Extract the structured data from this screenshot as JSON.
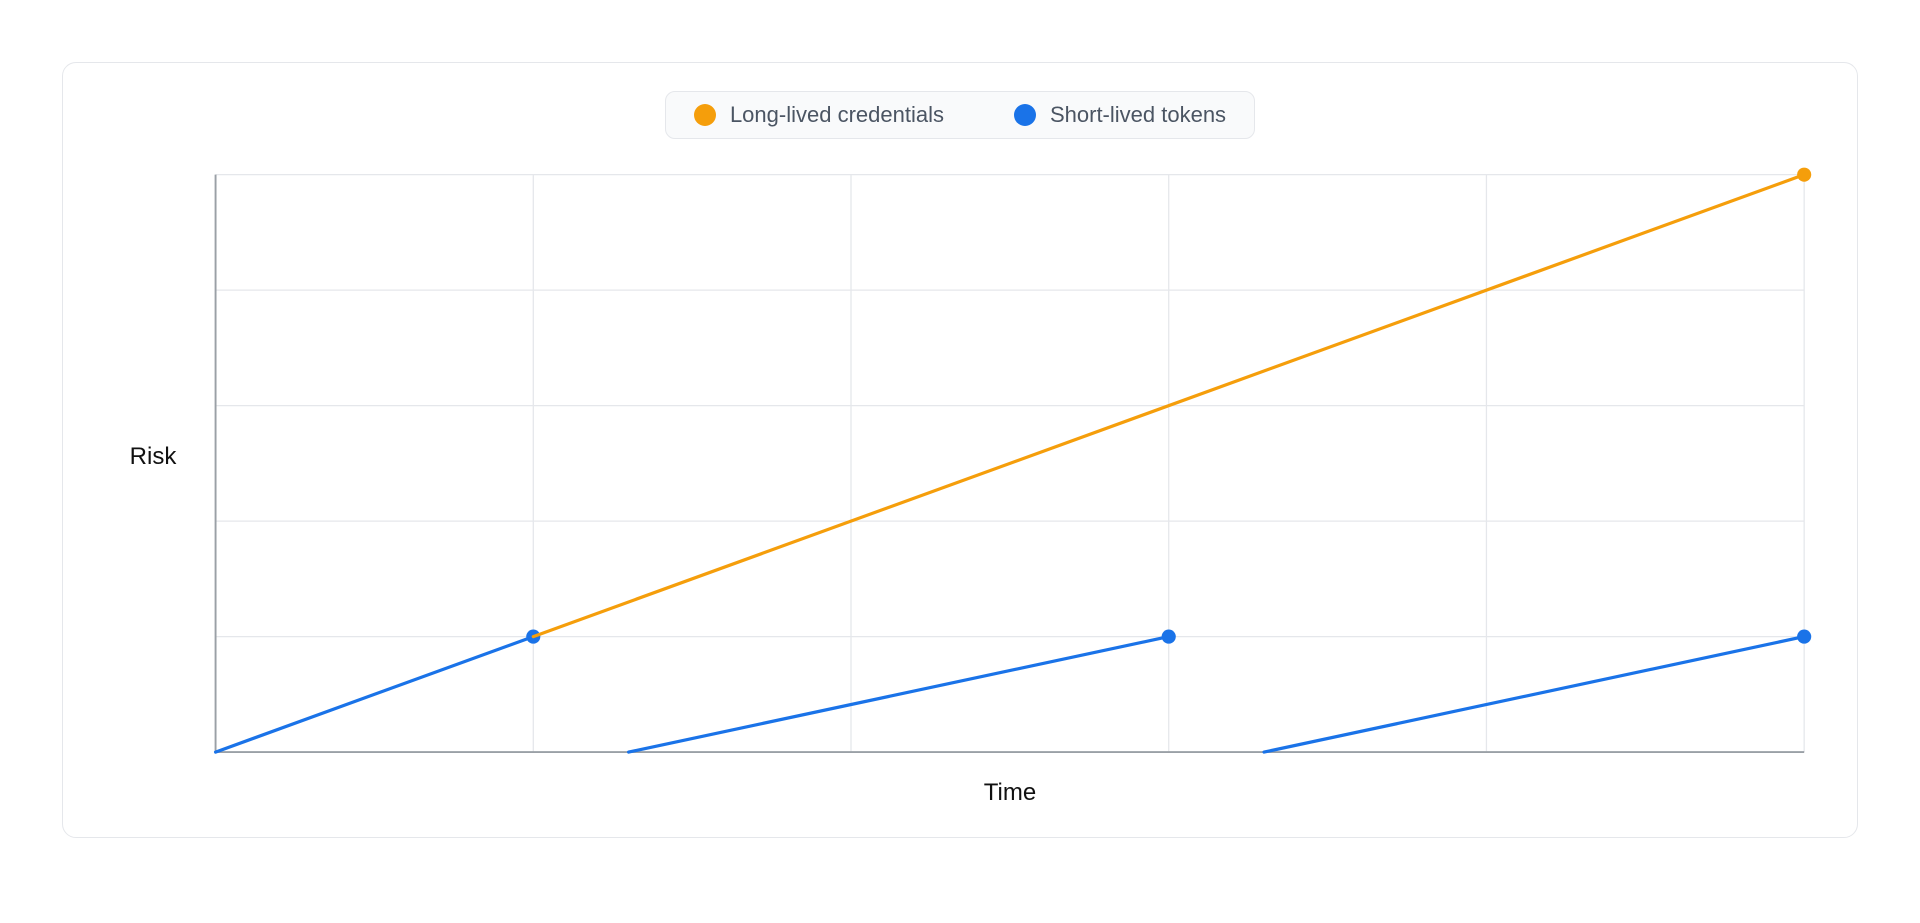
{
  "legend": {
    "series1": {
      "label": "Long-lived credentials",
      "color": "#f59e0b"
    },
    "series2": {
      "label": "Short-lived tokens",
      "color": "#1a73e8"
    }
  },
  "axes": {
    "ylabel": "Risk",
    "xlabel": "Time"
  },
  "chart_data": {
    "type": "line",
    "xlabel": "Time",
    "ylabel": "Risk",
    "xlim": [
      0,
      5
    ],
    "ylim": [
      0,
      5
    ],
    "grid": true,
    "series": [
      {
        "name": "Long-lived credentials",
        "color": "#f59e0b",
        "points": [
          {
            "x": 0,
            "y": 0
          },
          {
            "x": 5,
            "y": 5
          }
        ],
        "marker_at_end": true
      },
      {
        "name": "Short-lived tokens",
        "color": "#1a73e8",
        "segments": [
          {
            "points": [
              {
                "x": 0,
                "y": 0
              },
              {
                "x": 1,
                "y": 1
              }
            ],
            "marker_at_end": true
          },
          {
            "points": [
              {
                "x": 1.3,
                "y": 0
              },
              {
                "x": 3,
                "y": 1
              }
            ],
            "marker_at_end": true
          },
          {
            "points": [
              {
                "x": 3.3,
                "y": 0
              },
              {
                "x": 5,
                "y": 1
              }
            ],
            "marker_at_end": true
          }
        ]
      }
    ]
  }
}
